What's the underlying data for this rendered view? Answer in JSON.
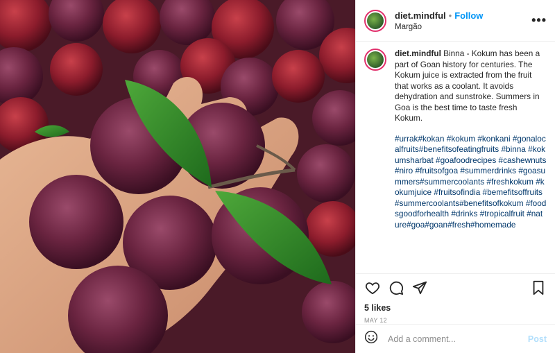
{
  "header": {
    "username": "diet.mindful",
    "separator": "•",
    "follow_label": "Follow",
    "location": "Margão",
    "more_label": "•••"
  },
  "caption": {
    "username": "diet.mindful",
    "text": "Binna - Kokum has been a part of Goan history for centuries. The Kokum juice is extracted from the fruit that works as a coolant. It avoids dehydration and sunstroke. Summers in Goa is the best time to taste fresh Kokum.",
    "hashtags": "#urrak#kokan #kokum #konkani #gonalocalfruits#benefitsofeatingfruits #binna #kokumsharbat #goafoodrecipes #cashewnuts #niro #fruitsofgoa #summerdrinks #goasummers#summercoolants #freshkokum #kokumjuice #fruitsofindia #bemefitsoffruits#summercoolants#benefitsofkokum #foodsgoodforhealth #drinks #tropicalfruit #nature#goa#goan#fresh#homemade"
  },
  "actions": {
    "icons": [
      "heart-icon",
      "comment-icon",
      "share-icon",
      "bookmark-icon"
    ]
  },
  "likes": "5 likes",
  "date": "MAY 12",
  "comment_box": {
    "placeholder": "Add a comment...",
    "post_label": "Post"
  },
  "photo": {
    "description_icons": [
      "kokum-fruit-photo"
    ]
  }
}
